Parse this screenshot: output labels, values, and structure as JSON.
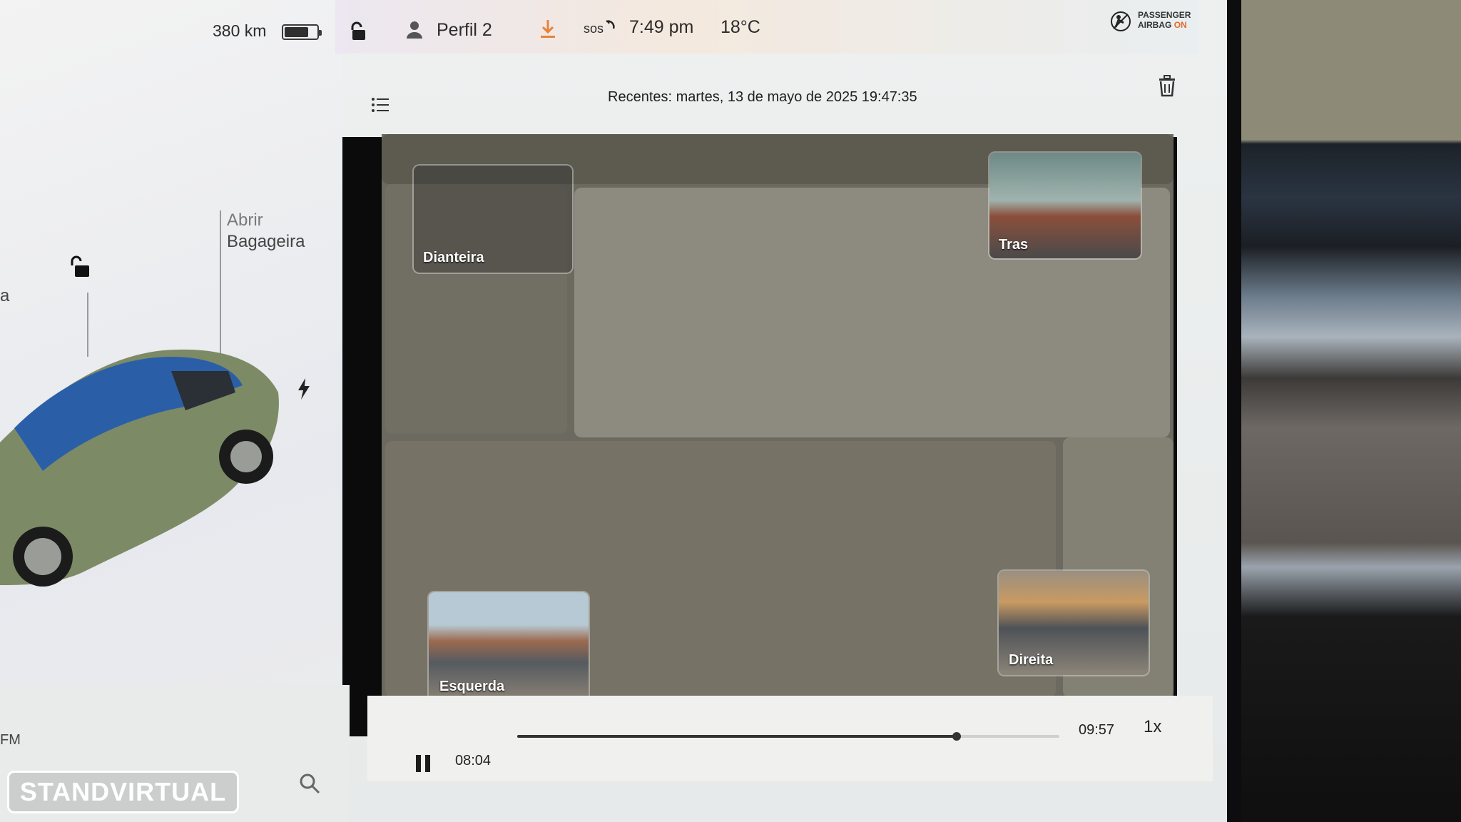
{
  "status_bar": {
    "range": "380 km",
    "battery_level": 0.75,
    "profile": "Perfil 2",
    "sos": "sos",
    "time": "7:49 pm",
    "temperature": "18°C",
    "airbag_line1": "PASSENGER",
    "airbag_line2": "AIRBAG",
    "airbag_state": "ON"
  },
  "car_panel": {
    "left_partial": "a",
    "trunk_label_1": "Abrir",
    "trunk_label_2": "Bagageira",
    "radio_band": "FM"
  },
  "viewer": {
    "title": "Recentes: martes, 13 de mayo de 2025 19:47:35",
    "cameras": {
      "front": "Dianteira",
      "rear": "Tras",
      "left": "Esquerda",
      "right": "Direita"
    }
  },
  "playback": {
    "current_time": "08:04",
    "total_time": "09:57",
    "progress": 0.81,
    "speed": "1x"
  },
  "watermark": "STANDVIRTUAL",
  "colors": {
    "accent_orange": "#e8833a",
    "airbag_on": "#e46a2c"
  }
}
